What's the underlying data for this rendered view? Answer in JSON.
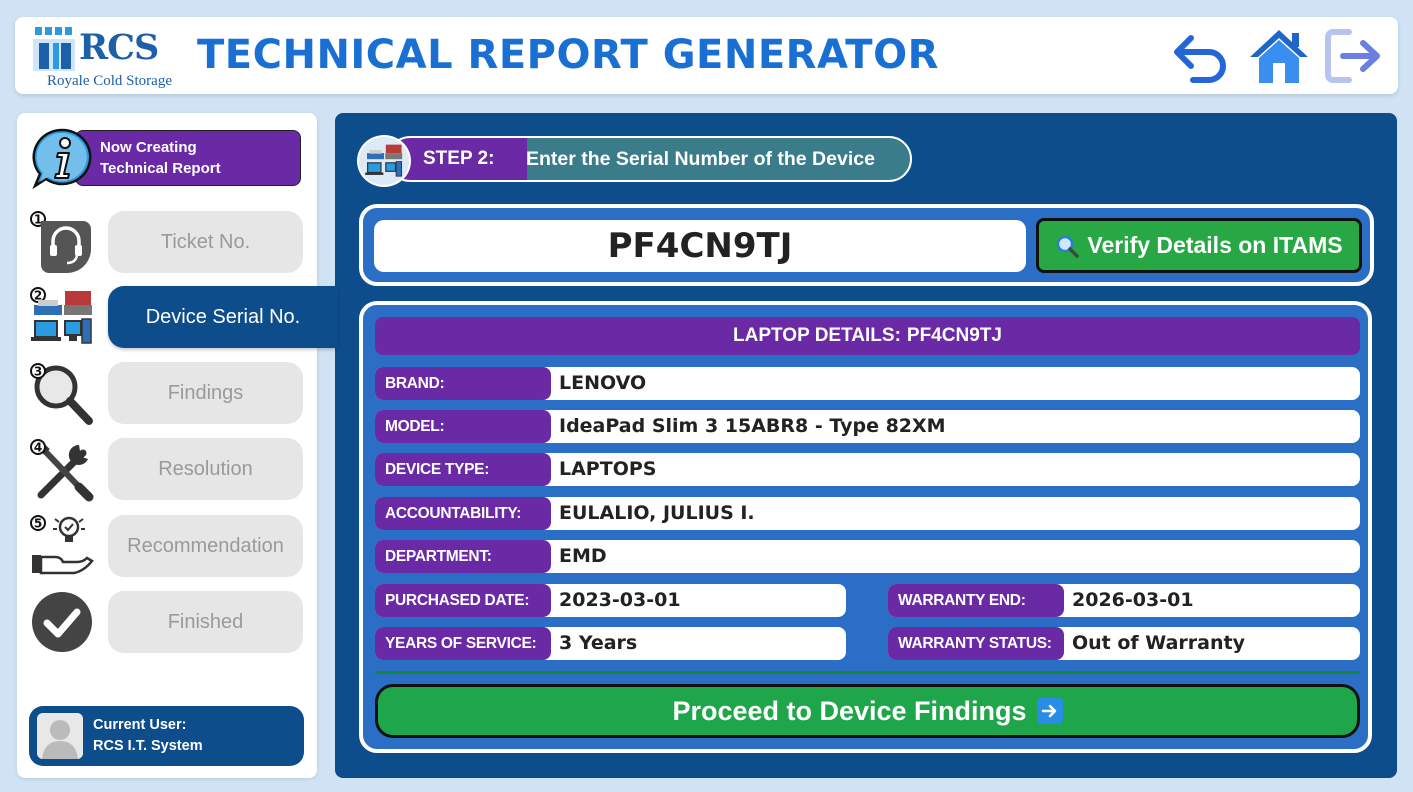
{
  "header": {
    "logo_abbr": "RCS",
    "logo_name": "Royale Cold Storage",
    "title": "TECHNICAL REPORT GENERATOR",
    "icons": [
      "undo-icon",
      "home-icon",
      "logout-icon"
    ],
    "accent": "#1a6fd3"
  },
  "sidebar": {
    "status_line1": "Now Creating",
    "status_line2": "Technical Report",
    "steps": [
      {
        "num": "1",
        "label": "Ticket No.",
        "icon": "headset-icon",
        "state": "inactive"
      },
      {
        "num": "2",
        "label": "Device Serial No.",
        "icon": "devices-icon",
        "state": "active"
      },
      {
        "num": "3",
        "label": "Findings",
        "icon": "magnifier-icon",
        "state": "inactive"
      },
      {
        "num": "4",
        "label": "Resolution",
        "icon": "tools-icon",
        "state": "inactive"
      },
      {
        "num": "5",
        "label": "Recommendation",
        "icon": "idea-hand-icon",
        "state": "inactive"
      },
      {
        "num": "",
        "label": "Finished",
        "icon": "check-circle-icon",
        "state": "inactive"
      }
    ],
    "user_label": "Current User:",
    "user_name": "RCS I.T. System"
  },
  "main": {
    "step_num": "STEP 2:",
    "step_desc": "Enter the Serial Number of the Device",
    "serial_value": "PF4CN9TJ",
    "verify_label": "Verify Details on ITAMS",
    "details_title_prefix": "LAPTOP DETAILS:",
    "details_title_serial": "PF4CN9TJ",
    "fields": {
      "brand": {
        "label": "BRAND:",
        "value": "LENOVO"
      },
      "model": {
        "label": "MODEL:",
        "value": "IdeaPad Slim 3 15ABR8 - Type 82XM"
      },
      "device_type": {
        "label": "DEVICE TYPE:",
        "value": "LAPTOPS"
      },
      "accountability": {
        "label": "ACCOUNTABILITY:",
        "value": "EULALIO, JULIUS I."
      },
      "department": {
        "label": "DEPARTMENT:",
        "value": "EMD"
      },
      "purchased_date": {
        "label": "PURCHASED DATE:",
        "value": "2023-03-01"
      },
      "warranty_end": {
        "label": "WARRANTY END:",
        "value": "2026-03-01"
      },
      "years_of_service": {
        "label": "YEARS OF SERVICE:",
        "value": "3 Years"
      },
      "warranty_status": {
        "label": "WARRANTY STATUS:",
        "value": "Out of Warranty"
      }
    },
    "proceed_label": "Proceed to Device Findings",
    "colors": {
      "panel": "#0e4d8c",
      "purple": "#6a2aa5",
      "green": "#1fa64a"
    }
  }
}
